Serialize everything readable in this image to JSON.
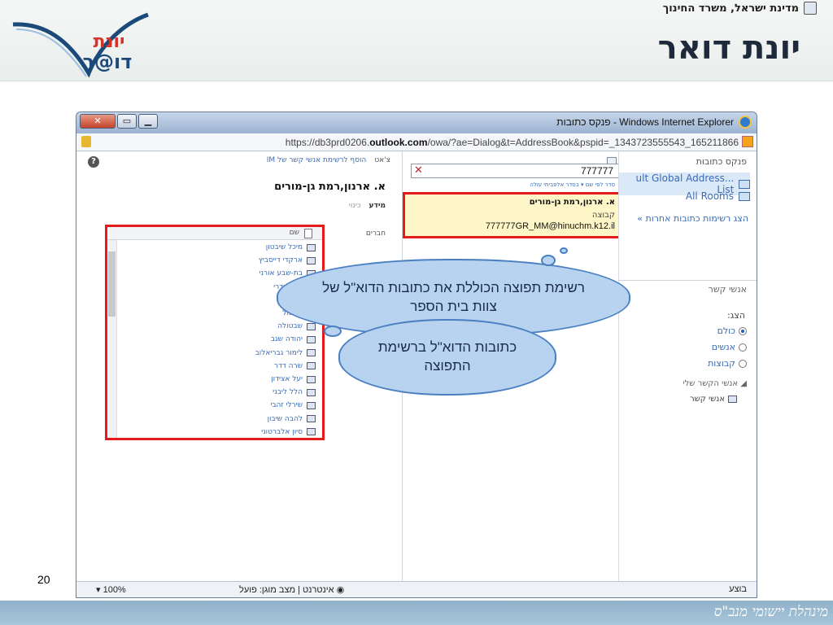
{
  "slide": {
    "gov_line": "מדינת ישראל, משרד החינוך",
    "title": "יונת דואר",
    "logo_title": "יונת",
    "logo_sub": "דו@ר",
    "page_number": "20",
    "footer": "מינהלת יישומי מנב\"ס"
  },
  "ie": {
    "window_title": "פנקס כתובות - Windows Internet Explorer",
    "url_prefix": "https://db3prd0206.",
    "url_domain": "outlook.com",
    "url_rest": "/owa/?ae=Dialog&t=AddressBook&pspid=_1343723555543_165211866",
    "status_zoom": "100%",
    "status_zone": "אינטרנט | מצב מוגן: פועל",
    "status_done": "בוצע"
  },
  "nav": {
    "title": "פנקס כתובות",
    "global_list": "...ult Global Address List",
    "rooms": "All Rooms",
    "other_lists": "הצג רשימות כתובות אחרות",
    "contacts_title": "אנשי קשר",
    "show_label": "הצג:",
    "radio_all": "כולם",
    "radio_people": "אנשים",
    "radio_groups": "קבוצות",
    "my_contacts": "אנשי הקשר שלי",
    "contacts_link": "אנשי קשר"
  },
  "results": {
    "search_value": "777777",
    "sort_line": "סדר לפי שם  ▾  בסדר אלפביתי עולה",
    "name": "א. ארנון,רמת גן-מורים",
    "type": "קבוצה",
    "email": "777777GR_MM@hinuchm.k12.il"
  },
  "detail": {
    "chat": "צ'אט",
    "add_im": "הוסף לרשימת אנשי קשר של IM",
    "name": "א. ארנון,רמת גן-מורים",
    "tab_info": "מידע",
    "tab_alias": "כינוי",
    "members_label": "חברים",
    "members_header": "שם",
    "members": [
      "מיכל שיבטון",
      "ארקדי דייסביץ",
      "בת-שבע אורני",
      "ציפי אדרי",
      "",
      "אשכול",
      "שבטולה",
      "יהודה שגב",
      "לימור גבריאלוב",
      "שרה דדר",
      "יעל אצידון",
      "הלל ליבני",
      "שירלי זהבי",
      "להבה שיבון",
      "סיון אלברטוני"
    ]
  },
  "callouts": {
    "big": "רשימת תפוצה הכוללת את כתובות הדוא\"ל של צוות בית הספר",
    "small": "כתובות הדוא\"ל ברשימת התפוצה"
  }
}
